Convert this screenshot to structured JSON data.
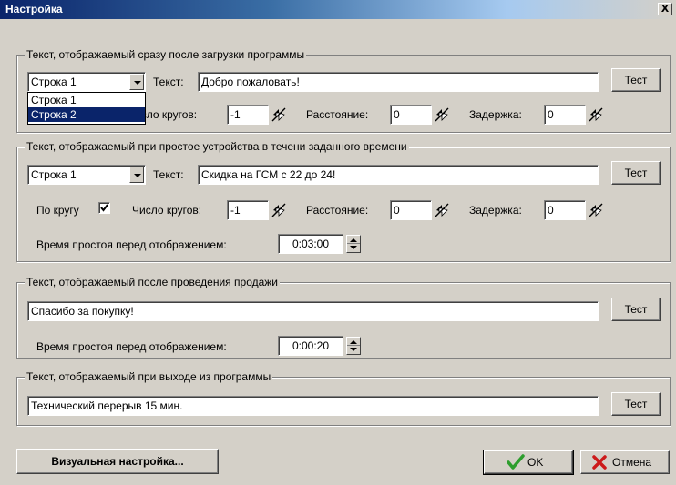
{
  "window": {
    "title": "Настройка",
    "close_glyph": "X"
  },
  "group1": {
    "legend": "Текст, отображаемый сразу после загрузки программы",
    "line_select": "Строка 1",
    "text_label": "Текст:",
    "text_value": "Добро пожаловать!",
    "test_button": "Тест",
    "loops_label": "Число кругов:",
    "loops_value": "-1",
    "distance_label": "Расстояние:",
    "distance_value": "0",
    "delay_label": "Задержка:",
    "delay_value": "0",
    "dropdown_options": [
      "Строка 1",
      "Строка 2"
    ],
    "dropdown_selected_index": 1
  },
  "group2": {
    "legend": "Текст, отображаемый при простое устройства в течени заданного времени",
    "line_select": "Строка 1",
    "text_label": "Текст:",
    "text_value": "Скидка на ГСМ  с 22 до 24!",
    "test_button": "Тест",
    "circular_label": "По кругу",
    "circular_checked": true,
    "loops_label": "Число кругов:",
    "loops_value": "-1",
    "distance_label": "Расстояние:",
    "distance_value": "0",
    "delay_label": "Задержка:",
    "delay_value": "0",
    "idle_label": "Время простоя перед отображением:",
    "idle_value": "0:03:00"
  },
  "group3": {
    "legend": "Текст, отображаемый после проведения продажи",
    "text_value": "Спасибо за покупку!",
    "test_button": "Тест",
    "idle_label": "Время простоя перед отображением:",
    "idle_value": "0:00:20"
  },
  "group4": {
    "legend": "Текст, отображаемый при выходе из программы",
    "text_value": "Технический перерыв 15 мин.",
    "test_button": "Тест"
  },
  "footer": {
    "visual_settings_button": "Визуальная настройка...",
    "ok_button": "OK",
    "cancel_button": "Отмена"
  },
  "colors": {
    "title_bar": "#0a246a",
    "face": "#d4d0c8",
    "ok_icon": "#2e9e2e",
    "cancel_icon": "#cc1a1a",
    "selection": "#0a246a"
  },
  "icons": {
    "close": "close-icon",
    "spin": "spin-arrows-icon",
    "ok": "checkmark-icon",
    "cancel": "x-mark-icon"
  }
}
